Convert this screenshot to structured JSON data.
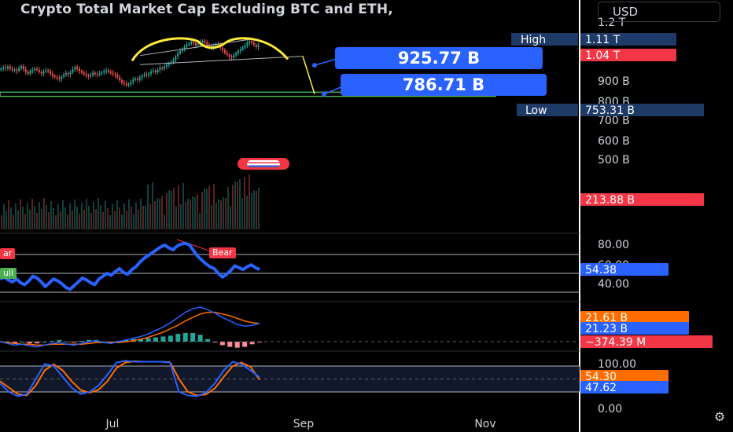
{
  "header": {
    "title": "Crypto Total Market Cap Excluding BTC and ETH,",
    "currency": "USD"
  },
  "colors": {
    "background": "#000000",
    "up": "#26a69a",
    "down": "#ef5350",
    "accent_blue": "#2962ff",
    "rsi_line": "#2962ff",
    "macd_line": "#2962ff",
    "signal_line": "#ff6d00",
    "pattern_highlight": "#ffeb3b",
    "support_box": "#4caf50"
  },
  "icons": {
    "event": "us-flag-icon",
    "settings": "gear-icon"
  },
  "callouts": {
    "target_1": "925.77 B",
    "target_2": "786.71 B"
  },
  "signals": {
    "bear_right": "Bear",
    "bear_left": "ar",
    "bull_left": "ull"
  },
  "chart_data": {
    "type": "candlestick",
    "title": "Crypto Total Market Cap Excluding BTC and ETH,",
    "x_ticks": [
      "Jul",
      "Sep",
      "Nov"
    ],
    "price_axis": {
      "scale": "log",
      "ticks": [
        "1.2 T",
        "900 B",
        "800 B",
        "700 B",
        "600 B",
        "500 B"
      ],
      "labels": [
        {
          "name": "High",
          "value": "1.11 T"
        },
        {
          "name": "",
          "value": "1.04 T"
        },
        {
          "name": "Low",
          "value": "753.31 B"
        }
      ]
    },
    "candles": {
      "approx_range": [
        753.31,
        1110
      ],
      "closes_approx": [
        905,
        912,
        908,
        918,
        903,
        896,
        899,
        891,
        907,
        921,
        902,
        885,
        873,
        890,
        897,
        904,
        898,
        884,
        876,
        888,
        895,
        889,
        874,
        861,
        854,
        848,
        842,
        856,
        868,
        877,
        870,
        883,
        900,
        914,
        903,
        891,
        880,
        872,
        865,
        858,
        866,
        879,
        873,
        868,
        875,
        881,
        889,
        895,
        885,
        879,
        873,
        866,
        852,
        836,
        823,
        817,
        808,
        814,
        826,
        839,
        845,
        838,
        851,
        862,
        870,
        864,
        875,
        887,
        893,
        884,
        897,
        910,
        905,
        917,
        929,
        938,
        946,
        958,
        984,
        1006,
        1021,
        1035,
        1053,
        1066,
        1075,
        1089,
        1078,
        1063,
        1071,
        1084,
        1093,
        1081,
        1068,
        1059,
        1047,
        1056,
        1071,
        1063,
        1045,
        1027,
        1008,
        996,
        983,
        975,
        992,
        1007,
        1021,
        1032,
        1047,
        1061,
        1078,
        1092,
        1080,
        1066,
        1051,
        1065
      ]
    },
    "projection": {
      "targets": [
        "925.77 B",
        "786.71 B"
      ]
    },
    "volume": {
      "last_label": "213.88 B"
    },
    "rsi": {
      "ticks": [
        "80.00",
        "60.00",
        "40.00"
      ],
      "levels": [
        70,
        50,
        30
      ],
      "last_label": "54.38",
      "values": [
        44,
        46,
        43,
        41,
        44,
        40,
        38,
        42,
        47,
        45,
        41,
        36,
        40,
        44,
        42,
        39,
        35,
        33,
        37,
        41,
        45,
        43,
        40,
        38,
        44,
        47,
        50,
        48,
        52,
        55,
        51,
        49,
        54,
        57,
        62,
        66,
        69,
        72,
        75,
        78,
        80,
        77,
        75,
        79,
        81,
        82,
        80,
        74,
        68,
        64,
        60,
        57,
        55,
        50,
        46,
        49,
        53,
        58,
        56,
        54,
        57,
        59,
        56,
        54
      ]
    },
    "macd": {
      "labels": [
        "21.61 B",
        "21.23 B",
        "−374.39 M"
      ],
      "macd_values": [
        0,
        -2,
        -4,
        -3,
        -5,
        -6,
        -4,
        -2,
        -1,
        -3,
        -4,
        -2,
        0,
        1,
        -1,
        -2,
        0,
        2,
        4,
        6,
        9,
        13,
        17,
        22,
        28,
        34,
        38,
        40,
        37,
        33,
        28,
        24,
        20,
        18,
        19,
        21
      ],
      "signal_values": [
        0,
        -1,
        -2,
        -3,
        -3,
        -4,
        -4,
        -3,
        -3,
        -3,
        -3,
        -3,
        -2,
        -1,
        -1,
        -1,
        -1,
        0,
        1,
        3,
        5,
        8,
        11,
        15,
        19,
        24,
        28,
        32,
        34,
        34,
        32,
        30,
        27,
        24,
        22,
        21
      ],
      "histogram": [
        0,
        -1,
        -2,
        0,
        -2,
        -2,
        0,
        1,
        2,
        0,
        -1,
        1,
        2,
        2,
        0,
        -1,
        1,
        2,
        3,
        3,
        4,
        5,
        6,
        7,
        9,
        10,
        10,
        8,
        3,
        -1,
        -4,
        -6,
        -7,
        -6,
        -3,
        -0.4
      ]
    },
    "stochastic": {
      "ticks": [
        "100.00",
        "0.00"
      ],
      "labels": [
        "54.30",
        "47.62"
      ],
      "k_values": [
        40,
        20,
        10,
        15,
        50,
        85,
        80,
        55,
        30,
        15,
        20,
        35,
        60,
        88,
        92,
        90,
        90,
        90,
        90,
        88,
        20,
        12,
        10,
        18,
        40,
        70,
        90,
        84,
        70,
        54
      ],
      "d_values": [
        45,
        30,
        15,
        12,
        35,
        70,
        84,
        70,
        45,
        25,
        18,
        25,
        45,
        75,
        88,
        91,
        90,
        90,
        90,
        89,
        50,
        20,
        12,
        14,
        28,
        55,
        80,
        88,
        78,
        48
      ]
    }
  }
}
